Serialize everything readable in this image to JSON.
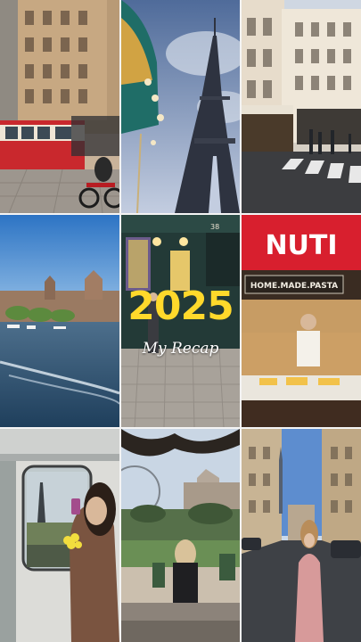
{
  "overlay": {
    "year": "2025",
    "subtitle": "My Recap"
  },
  "tiles": [
    {
      "id": 1,
      "description_name": "prague-tram-street"
    },
    {
      "id": 2,
      "description_name": "eiffel-tower-carousel"
    },
    {
      "id": 3,
      "description_name": "paris-street-crosswalk"
    },
    {
      "id": 4,
      "description_name": "river-waterfront"
    },
    {
      "id": 5,
      "description_name": "old-shopfront-cobblestone"
    },
    {
      "id": 6,
      "description_name": "nuti-shop-counter"
    },
    {
      "id": 7,
      "description_name": "train-window-eiffel"
    },
    {
      "id": 8,
      "description_name": "park-ferris-wheel"
    },
    {
      "id": 9,
      "description_name": "paris-street-woman"
    }
  ],
  "signs": {
    "nuti": "NUTI",
    "home_made_pasta": "HOME.MADE.PASTA",
    "shop_number": "38"
  },
  "colors": {
    "year_yellow": "#ffd92b",
    "nuti_red": "#d81f2e"
  }
}
